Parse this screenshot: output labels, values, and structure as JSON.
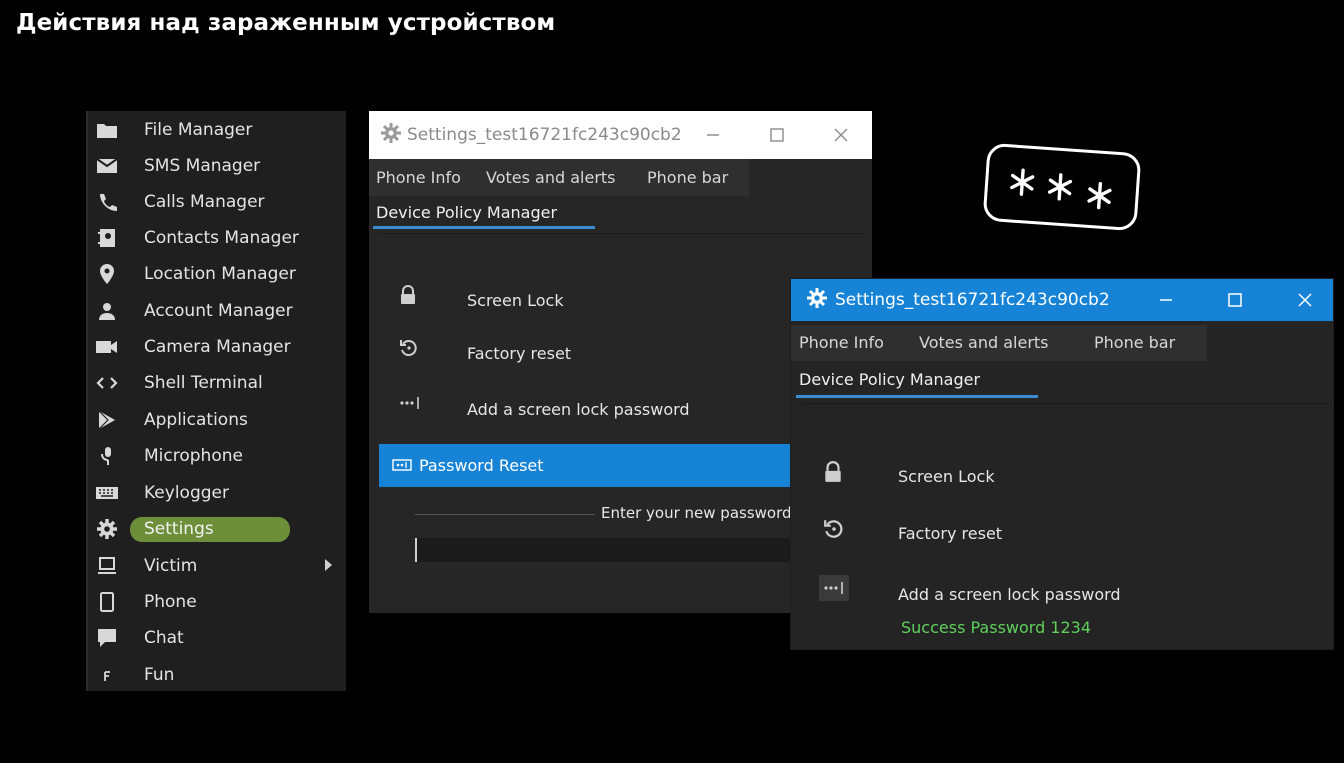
{
  "slide": {
    "title": "Действия над зараженным устройством"
  },
  "sidemenu": {
    "items": [
      {
        "label": "File Manager",
        "icon": "folder-icon"
      },
      {
        "label": "SMS Manager",
        "icon": "envelope-icon"
      },
      {
        "label": "Calls Manager",
        "icon": "phone-handset-icon"
      },
      {
        "label": "Contacts Manager",
        "icon": "contacts-book-icon"
      },
      {
        "label": "Location Manager",
        "icon": "location-pin-icon"
      },
      {
        "label": "Account Manager",
        "icon": "person-icon"
      },
      {
        "label": "Camera Manager",
        "icon": "camera-icon"
      },
      {
        "label": "Shell Terminal",
        "icon": "code-brackets-icon"
      },
      {
        "label": "Applications",
        "icon": "play-store-icon"
      },
      {
        "label": "Microphone",
        "icon": "microphone-icon"
      },
      {
        "label": "Keylogger",
        "icon": "keyboard-icon"
      },
      {
        "label": "Settings",
        "icon": "gear-icon",
        "active": true
      },
      {
        "label": "Victim",
        "icon": "monitor-icon",
        "submenu": true
      },
      {
        "label": "Phone",
        "icon": "smartphone-icon"
      },
      {
        "label": "Chat",
        "icon": "chat-bubble-icon"
      },
      {
        "label": "Fun",
        "icon": "fun-icon"
      }
    ],
    "active_color": "#6e8f3a"
  },
  "window_back": {
    "title": "Settings_test16721fc243c90cb2",
    "tabs": [
      "Phone Info",
      "Votes and alerts",
      "Phone bar"
    ],
    "active_tab": "Device Policy Manager",
    "rows": [
      {
        "label": "Screen Lock",
        "icon": "lock-icon"
      },
      {
        "label": "Factory reset",
        "icon": "reset-icon"
      },
      {
        "label": "Add a screen lock password",
        "icon": "password-dots-icon"
      }
    ],
    "dialog": {
      "title": "Password Reset",
      "prompt": "Enter your new password",
      "input_value": ""
    }
  },
  "window_front": {
    "title": "Settings_test16721fc243c90cb2",
    "tabs": [
      "Phone Info",
      "Votes and alerts",
      "Phone bar"
    ],
    "active_tab": "Device Policy Manager",
    "rows": [
      {
        "label": "Screen Lock",
        "icon": "lock-icon"
      },
      {
        "label": "Factory reset",
        "icon": "reset-icon"
      },
      {
        "label": "Add a screen lock password",
        "icon": "password-dots-icon"
      }
    ],
    "status": "Success Password 1234",
    "accent_color": "#1683d7",
    "status_color": "#5fd05a"
  }
}
